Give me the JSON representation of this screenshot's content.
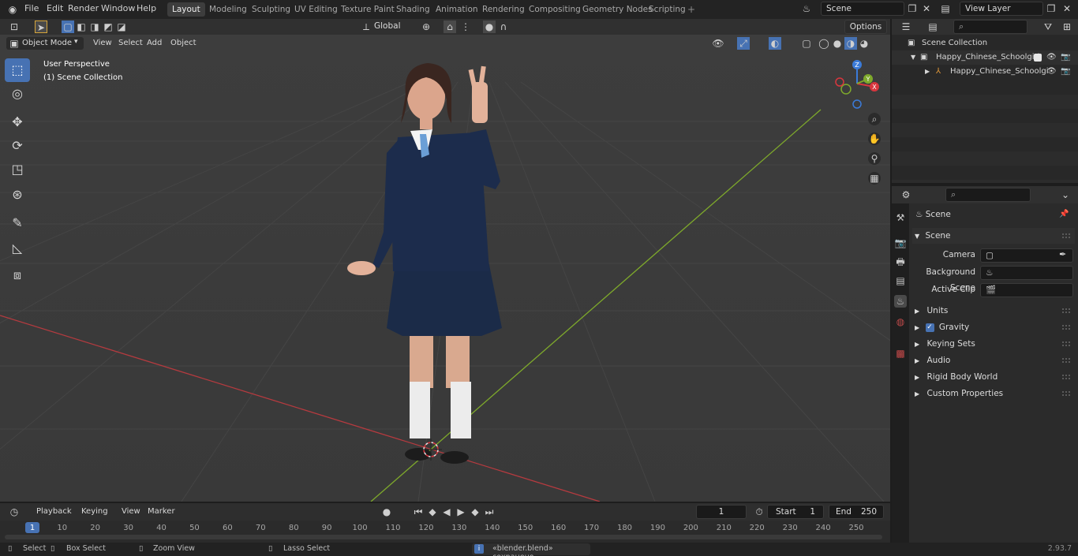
{
  "menu": [
    "File",
    "Edit",
    "Render",
    "Window",
    "Help"
  ],
  "workspaces": [
    "Layout",
    "Modeling",
    "Sculpting",
    "UV Editing",
    "Texture Paint",
    "Shading",
    "Animation",
    "Rendering",
    "Compositing",
    "Geometry Nodes",
    "Scripting"
  ],
  "active_workspace": "Layout",
  "scene_name": "Scene",
  "view_layer": "View Layer",
  "viewport": {
    "mode": "Object Mode",
    "menus": [
      "View",
      "Select",
      "Add",
      "Object"
    ],
    "orientation": "Global",
    "options_label": "Options",
    "overlay_title": "User Perspective",
    "overlay_collection": "(1) Scene Collection",
    "gizmo_axes": {
      "x": "X",
      "y": "Y",
      "z": "Z"
    }
  },
  "outliner": {
    "root": "Scene Collection",
    "items": [
      "Happy_Chinese_Schoolgirl",
      "Happy_Chinese_Schoolgi"
    ]
  },
  "properties": {
    "context": "Scene",
    "panel_title": "Scene",
    "camera_label": "Camera",
    "background_label": "Background Scene",
    "clip_label": "Active Clip",
    "sections": [
      "Units",
      "Gravity",
      "Keying Sets",
      "Audio",
      "Rigid Body World",
      "Custom Properties"
    ]
  },
  "timeline": {
    "menus": [
      "Playback",
      "Keying",
      "View",
      "Marker"
    ],
    "current_frame": "1",
    "start_label": "Start",
    "start": "1",
    "end_label": "End",
    "end": "250",
    "ticks": [
      "1",
      "10",
      "20",
      "30",
      "40",
      "50",
      "60",
      "70",
      "80",
      "90",
      "100",
      "110",
      "120",
      "130",
      "140",
      "150",
      "160",
      "170",
      "180",
      "190",
      "200",
      "210",
      "220",
      "230",
      "240",
      "250"
    ]
  },
  "status": {
    "select": "Select",
    "box_select": "Box Select",
    "zoom_view": "Zoom View",
    "lasso_select": "Lasso Select",
    "message": "«blender.blend» сохранено",
    "version": "2.93.7"
  },
  "colors": {
    "accent": "#4772b3",
    "x_axis": "#d9363e",
    "y_axis": "#7ea92b",
    "z_axis": "#3b7bd9"
  }
}
